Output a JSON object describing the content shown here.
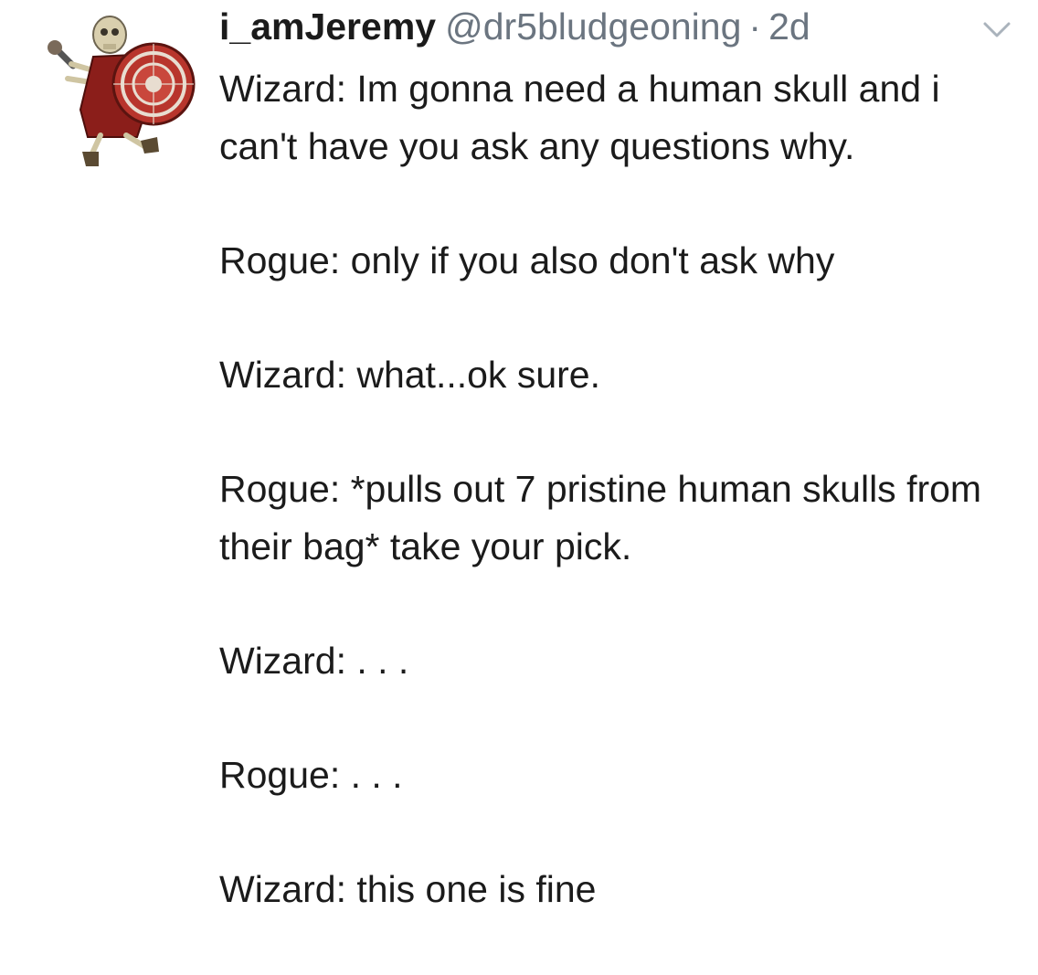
{
  "tweet": {
    "display_name": "i_amJeremy",
    "handle": "@dr5bludgeoning",
    "separator": "·",
    "time": "2d",
    "avatar_icon": "skeleton-warrior-avatar",
    "menu_icon": "chevron-down-icon",
    "paragraphs": [
      "Wizard: Im gonna need a human skull and i can't have you ask any questions why.",
      "Rogue: only if you also don't ask why",
      "Wizard: what...ok sure.",
      "Rogue: *pulls out 7 pristine human skulls from their bag* take your pick.",
      "Wizard: . . .",
      "Rogue: . . .",
      "Wizard: this one is fine"
    ]
  },
  "colors": {
    "text": "#1b1b1b",
    "secondary": "#6b7580",
    "background": "#ffffff",
    "tunic": "#8b1e1a",
    "bone": "#d9cfae"
  }
}
